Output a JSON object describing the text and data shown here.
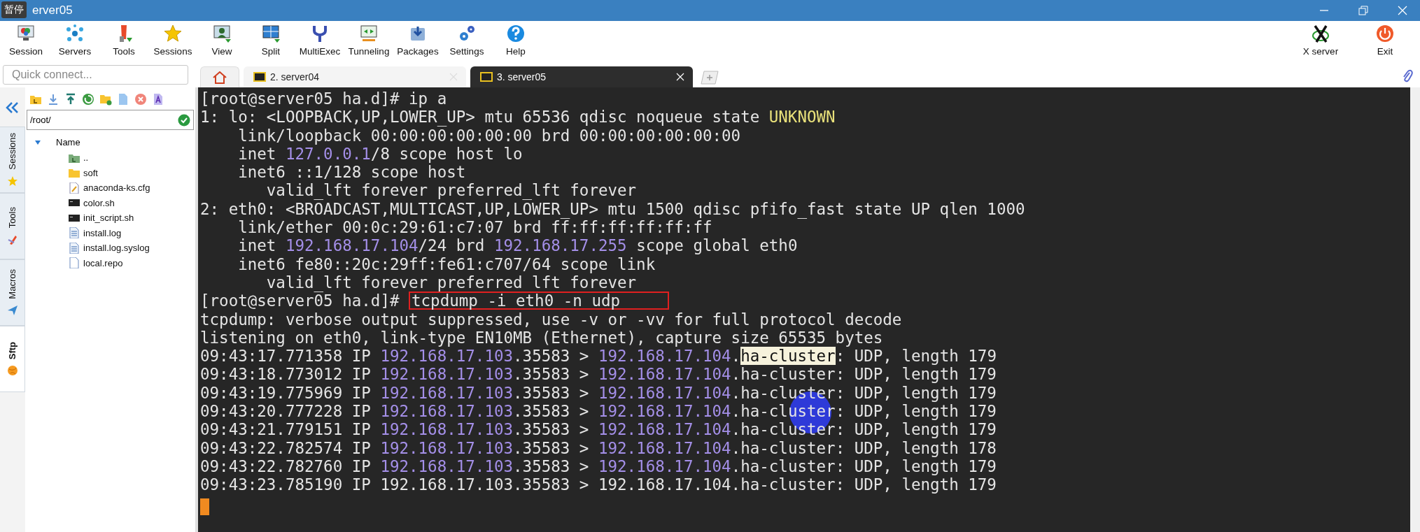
{
  "window": {
    "title": "erver05",
    "overlay_label": "暂停"
  },
  "toolbar": [
    {
      "label": "Session"
    },
    {
      "label": "Servers"
    },
    {
      "label": "Tools"
    },
    {
      "label": "Sessions"
    },
    {
      "label": "View"
    },
    {
      "label": "Split"
    },
    {
      "label": "MultiExec"
    },
    {
      "label": "Tunneling"
    },
    {
      "label": "Packages"
    },
    {
      "label": "Settings"
    },
    {
      "label": "Help"
    }
  ],
  "toolbar_right": [
    {
      "label": "X server"
    },
    {
      "label": "Exit"
    }
  ],
  "quick_connect": {
    "placeholder": "Quick connect..."
  },
  "tabs": [
    {
      "label": "2. server04",
      "selected": false
    },
    {
      "label": "3. server05",
      "selected": true
    }
  ],
  "side_tabs": [
    {
      "label": "Sessions",
      "selected": false
    },
    {
      "label": "Tools",
      "selected": false
    },
    {
      "label": "Macros",
      "selected": false
    },
    {
      "label": "Sftp",
      "selected": true
    }
  ],
  "sftp": {
    "path": "/root/",
    "column": "Name",
    "files": [
      {
        "name": "..",
        "kind": "parent"
      },
      {
        "name": "soft",
        "kind": "folder"
      },
      {
        "name": "anaconda-ks.cfg",
        "kind": "config"
      },
      {
        "name": "color.sh",
        "kind": "script"
      },
      {
        "name": "init_script.sh",
        "kind": "script"
      },
      {
        "name": "install.log",
        "kind": "text"
      },
      {
        "name": "install.log.syslog",
        "kind": "text"
      },
      {
        "name": "local.repo",
        "kind": "file"
      }
    ]
  },
  "terminal": {
    "lines": [
      [
        {
          "text": "[root@server05 ha.d]# ip a",
          "kind": "plain"
        }
      ],
      [
        {
          "text": "1: lo: <LOOPBACK,UP,LOWER_UP> mtu 65536 qdisc noqueue state ",
          "kind": "plain"
        },
        {
          "text": "UNKNOWN",
          "kind": "warn"
        }
      ],
      [
        {
          "text": "    link/loopback 00:00:00:00:00:00 brd 00:00:00:00:00:00",
          "kind": "plain"
        }
      ],
      [
        {
          "text": "    inet ",
          "kind": "plain"
        },
        {
          "text": "127.0.0.1",
          "kind": "ip"
        },
        {
          "text": "/8 scope host lo",
          "kind": "plain"
        }
      ],
      [
        {
          "text": "    inet6 ::1/128 scope host",
          "kind": "plain"
        }
      ],
      [
        {
          "text": "       valid_lft forever preferred_lft forever",
          "kind": "plain"
        }
      ],
      [
        {
          "text": "2: eth0: <BROADCAST,MULTICAST,UP,LOWER_UP> mtu 1500 qdisc pfifo_fast state UP qlen 1000",
          "kind": "plain"
        }
      ],
      [
        {
          "text": "    link/ether 00:0c:29:61:c7:07 brd ff:ff:ff:ff:ff:ff",
          "kind": "plain"
        }
      ],
      [
        {
          "text": "    inet ",
          "kind": "plain"
        },
        {
          "text": "192.168.17.104",
          "kind": "ip"
        },
        {
          "text": "/24 brd ",
          "kind": "plain"
        },
        {
          "text": "192.168.17.255",
          "kind": "ip"
        },
        {
          "text": " scope global eth0",
          "kind": "plain"
        }
      ],
      [
        {
          "text": "    inet6 fe80::20c:29ff:fe61:c707/64 scope link",
          "kind": "plain"
        }
      ],
      [
        {
          "text": "       valid_lft forever preferred_lft forever",
          "kind": "plain"
        }
      ],
      [
        {
          "text": "[root@server05 ha.d]# ",
          "kind": "plain"
        },
        {
          "text": "tcpdump -i eth0 -n udp",
          "kind": "boxed"
        }
      ],
      [
        {
          "text": "tcpdump: verbose output suppressed, use -v or -vv for full protocol decode",
          "kind": "plain"
        }
      ],
      [
        {
          "text": "listening on eth0, link-type EN10MB (Ethernet), capture size 65535 bytes",
          "kind": "plain"
        }
      ],
      [
        {
          "text": "09:43:17.771358 IP ",
          "kind": "plain"
        },
        {
          "text": "192.168.17.103",
          "kind": "ip"
        },
        {
          "text": ".35583 > ",
          "kind": "plain"
        },
        {
          "text": "192.168.17.104",
          "kind": "ip"
        },
        {
          "text": ".",
          "kind": "plain"
        },
        {
          "text": "ha-cluster",
          "kind": "selected"
        },
        {
          "text": ": UDP, length 179",
          "kind": "plain"
        }
      ],
      [
        {
          "text": "09:43:18.773012 IP ",
          "kind": "plain"
        },
        {
          "text": "192.168.17.103",
          "kind": "ip"
        },
        {
          "text": ".35583 > ",
          "kind": "plain"
        },
        {
          "text": "192.168.17.104",
          "kind": "ip"
        },
        {
          "text": ".ha-cluster: UDP, length 179",
          "kind": "plain"
        }
      ],
      [
        {
          "text": "09:43:19.775969 IP ",
          "kind": "plain"
        },
        {
          "text": "192.168.17.103",
          "kind": "ip"
        },
        {
          "text": ".35583 > ",
          "kind": "plain"
        },
        {
          "text": "192.168.17.104",
          "kind": "ip"
        },
        {
          "text": ".ha-cluster: UDP, length 179",
          "kind": "plain"
        }
      ],
      [
        {
          "text": "09:43:20.777228 IP ",
          "kind": "plain"
        },
        {
          "text": "192.168.17.103",
          "kind": "ip"
        },
        {
          "text": ".35583 > ",
          "kind": "plain"
        },
        {
          "text": "192.168.17.104",
          "kind": "ip"
        },
        {
          "text": ".ha-cluster: UDP, length 179",
          "kind": "plain"
        }
      ],
      [
        {
          "text": "09:43:21.779151 IP ",
          "kind": "plain"
        },
        {
          "text": "192.168.17.103",
          "kind": "ip"
        },
        {
          "text": ".35583 > ",
          "kind": "plain"
        },
        {
          "text": "192.168.17.104",
          "kind": "ip"
        },
        {
          "text": ".ha-cluster: UDP, length 179",
          "kind": "plain"
        }
      ],
      [
        {
          "text": "09:43:22.782574 IP ",
          "kind": "plain"
        },
        {
          "text": "192.168.17.103",
          "kind": "ip"
        },
        {
          "text": ".35583 > ",
          "kind": "plain"
        },
        {
          "text": "192.168.17.104",
          "kind": "ip"
        },
        {
          "text": ".ha-cluster: UDP, length 178",
          "kind": "plain"
        }
      ],
      [
        {
          "text": "09:43:22.782760 IP ",
          "kind": "plain"
        },
        {
          "text": "192.168.17.103",
          "kind": "ip"
        },
        {
          "text": ".35583 > ",
          "kind": "plain"
        },
        {
          "text": "192.168.17.104",
          "kind": "ip"
        },
        {
          "text": ".ha-cluster: UDP, length 179",
          "kind": "plain"
        }
      ],
      [
        {
          "text": "09:43:23.785190 IP 192.168.17.103.35583 > 192.168.17.104.ha-cluster: UDP, length 179",
          "kind": "plain"
        }
      ]
    ]
  }
}
